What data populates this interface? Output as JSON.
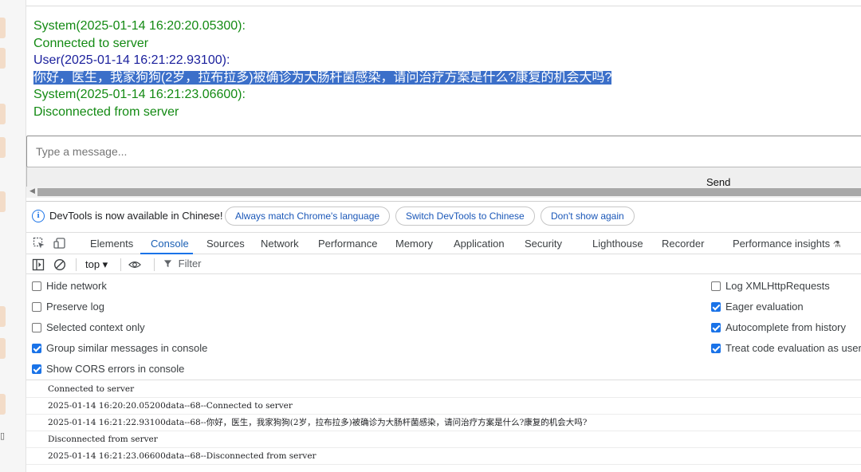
{
  "chat": {
    "messages": [
      {
        "header": "System(2025-01-14 16:20:20.05300):",
        "text": "Connected to server",
        "role": "system"
      },
      {
        "header": "User(2025-01-14 16:21:22.93100):",
        "text": "你好，医生，我家狗狗(2岁，拉布拉多)被确诊为大肠杆菌感染，请问治疗方案是什么?康复的机会大吗?",
        "role": "user",
        "selected": true
      },
      {
        "header": "System(2025-01-14 16:21:23.06600):",
        "text": "Disconnected from server",
        "role": "system"
      }
    ],
    "input_placeholder": "Type a message...",
    "send_label": "Send"
  },
  "devtools": {
    "infobar": {
      "text": "DevTools is now available in Chinese!",
      "always_match": "Always match Chrome's language",
      "switch": "Switch DevTools to Chinese",
      "dont_show": "Don't show again"
    },
    "tabs": [
      "Elements",
      "Console",
      "Sources",
      "Network",
      "Performance",
      "Memory",
      "Application",
      "Security",
      "Lighthouse",
      "Recorder",
      "Performance insights"
    ],
    "active_tab": "Console",
    "toolbar": {
      "context": "top ▾",
      "filter": "Filter"
    },
    "settings_left": [
      {
        "label": "Hide network",
        "checked": false
      },
      {
        "label": "Preserve log",
        "checked": false
      },
      {
        "label": "Selected context only",
        "checked": false
      },
      {
        "label": "Group similar messages in console",
        "checked": true
      },
      {
        "label": "Show CORS errors in console",
        "checked": true
      }
    ],
    "settings_right": [
      {
        "label": "Log XMLHttpRequests",
        "checked": false
      },
      {
        "label": "Eager evaluation",
        "checked": true
      },
      {
        "label": "Autocomplete from history",
        "checked": true
      },
      {
        "label": "Treat code evaluation as user",
        "checked": true
      }
    ],
    "console_messages": [
      "Connected to server",
      "2025-01-14 16:20:20.05200data--68--Connected to server",
      "2025-01-14 16:21:22.93100data--68--你好，医生，我家狗狗(2岁，拉布拉多)被确诊为大肠杆菌感染，请问治疗方案是什么?康复的机会大吗?",
      "Disconnected from server",
      "2025-01-14 16:21:23.06600data--68--Disconnected from server"
    ]
  },
  "colors": {
    "system_text": "#138a13",
    "user_text": "#1a1f9c",
    "selection": "#3b6fc9",
    "devtools_accent": "#1a73e8"
  }
}
